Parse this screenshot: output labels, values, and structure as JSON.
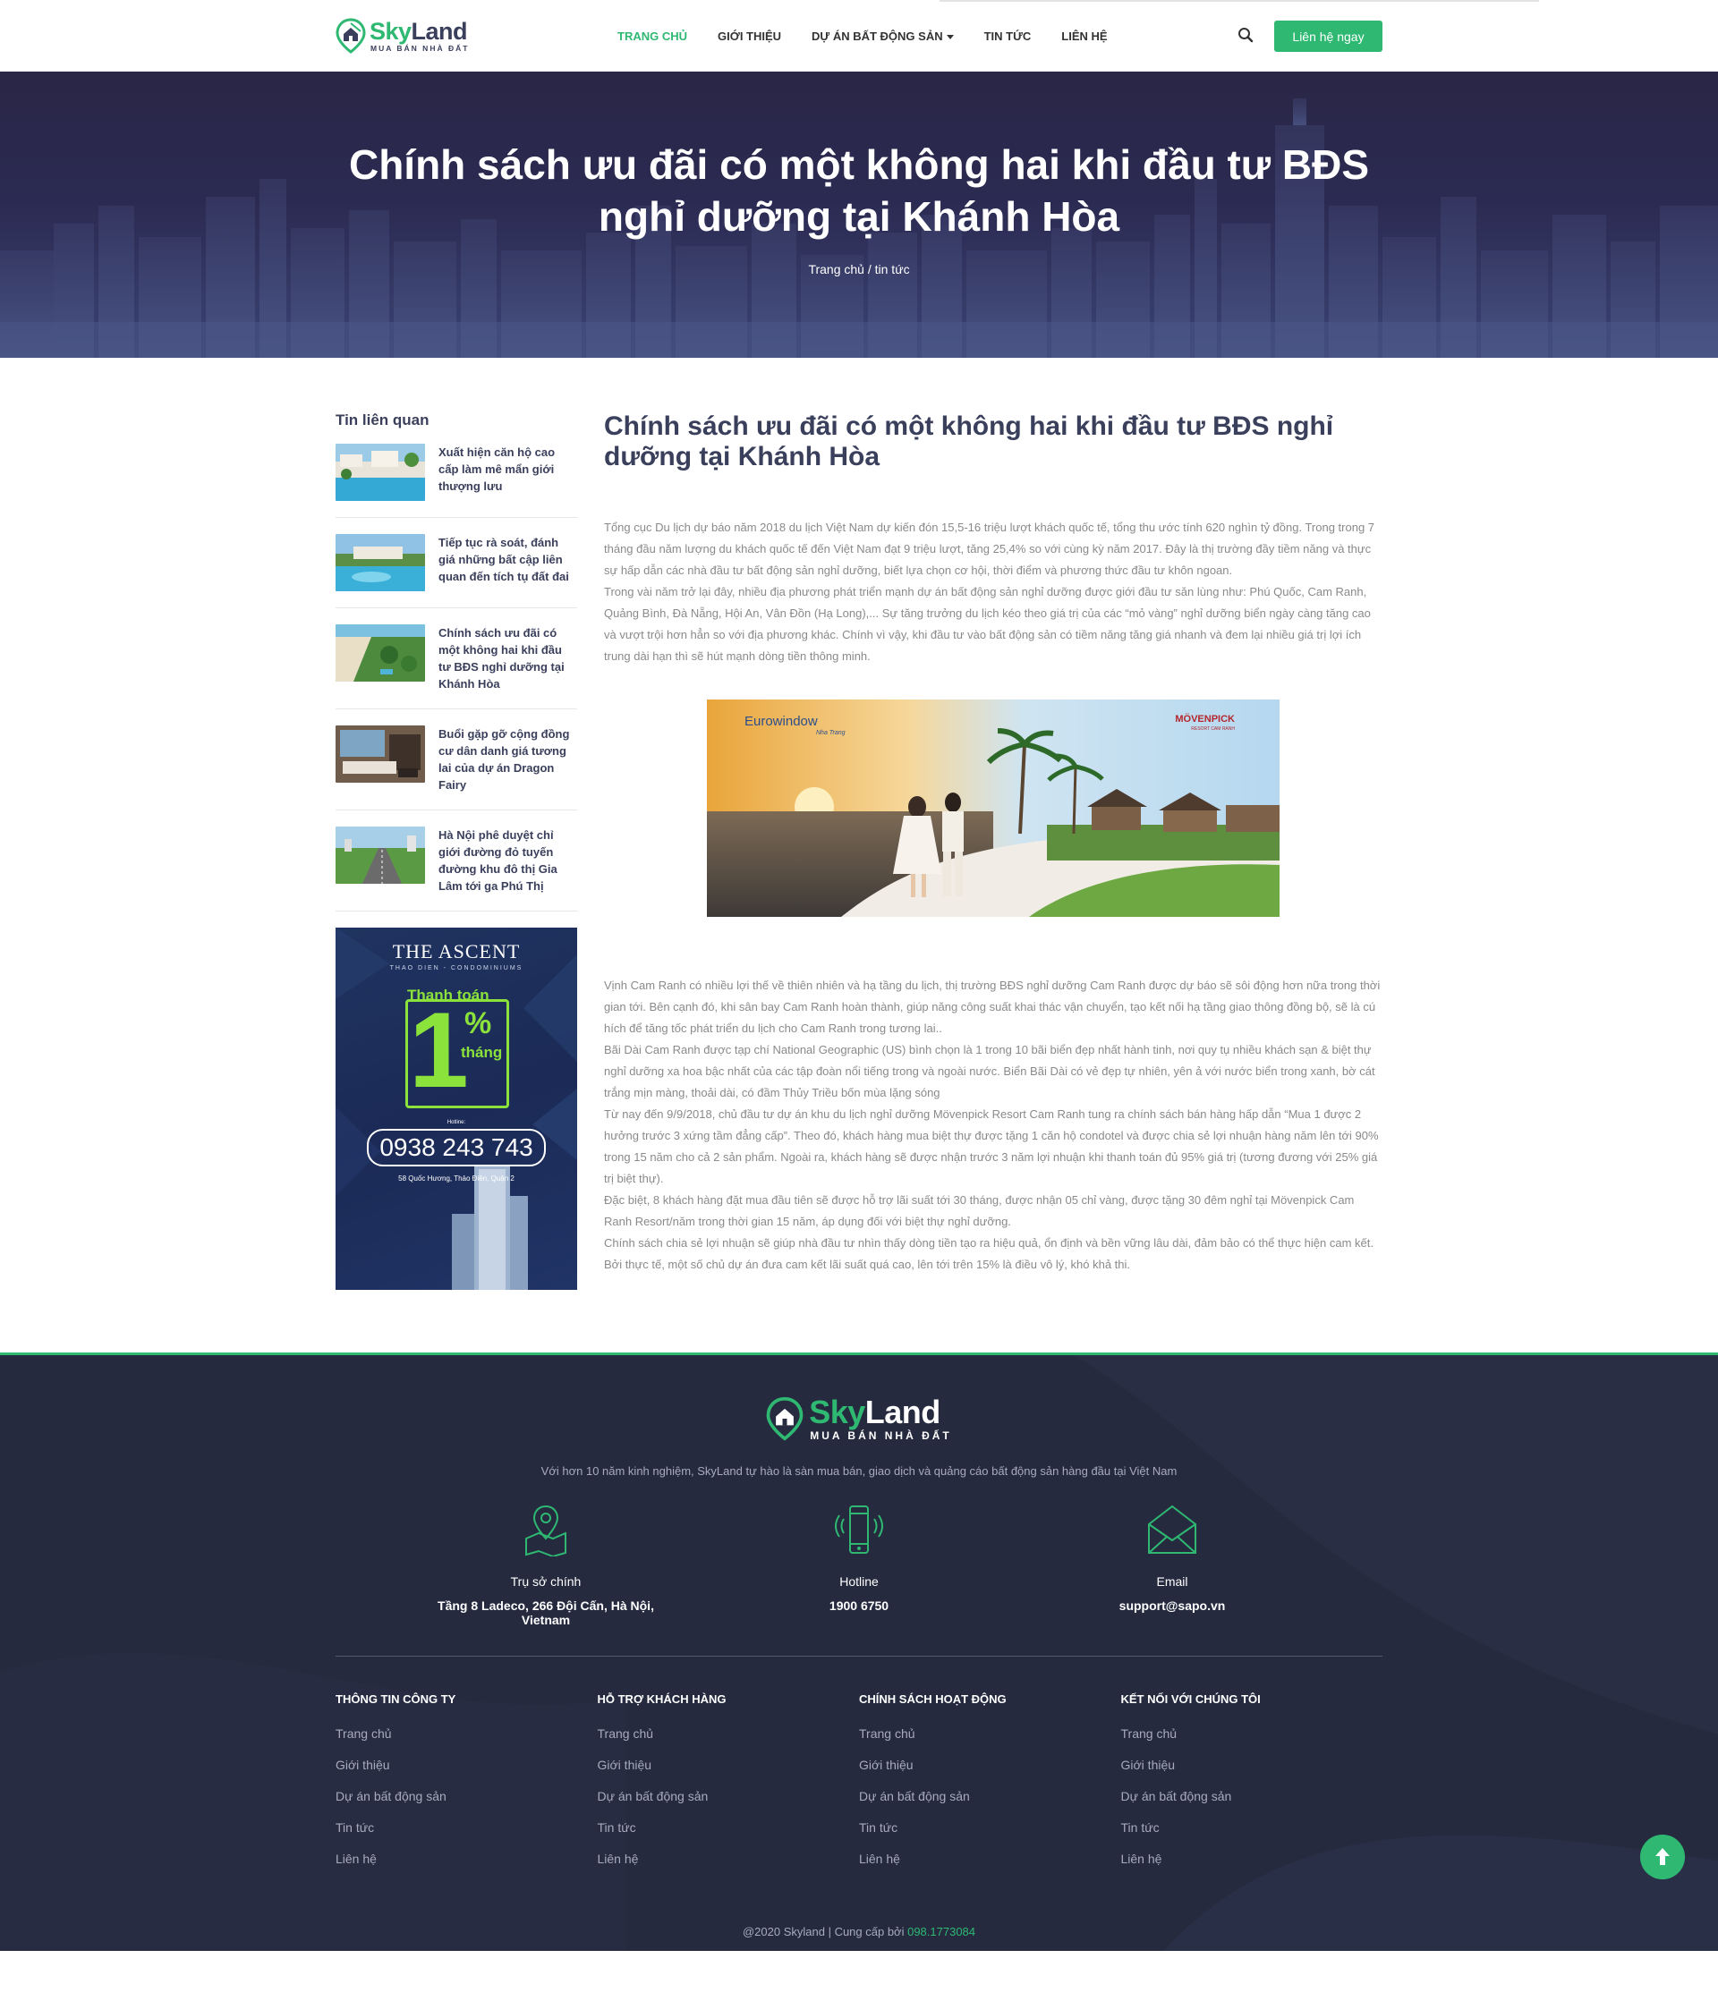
{
  "header": {
    "logo_brand_sky": "Sky",
    "logo_brand_land": "Land",
    "logo_tagline": "MUA BÁN NHÀ ĐẤT",
    "nav": [
      {
        "label": "TRANG CHỦ",
        "active": true
      },
      {
        "label": "GIỚI THIỆU"
      },
      {
        "label": "DỰ ÁN BẤT ĐỘNG SẢN",
        "dropdown": true
      },
      {
        "label": "TIN TỨC"
      },
      {
        "label": "LIÊN HỆ"
      }
    ],
    "cta_label": "Liên hệ ngay",
    "search_icon": "search-icon"
  },
  "hero": {
    "title": "Chính sách ưu đãi có một không hai khi đầu tư BĐS nghỉ dưỡng tại Khánh Hòa",
    "breadcrumb_home": "Trang chủ",
    "breadcrumb_sep": " / ",
    "breadcrumb_current": "tin tức"
  },
  "sidebar": {
    "title": "Tin liên quan",
    "items": [
      {
        "title": "Xuất hiện căn hộ cao cấp làm mê mẩn giới thượng lưu"
      },
      {
        "title": "Tiếp tục rà soát, đánh giá những bất cập liên quan đến tích tụ đất đai"
      },
      {
        "title": "Chính sách ưu đãi có một không hai khi đầu tư BĐS nghỉ dưỡng tại Khánh Hòa"
      },
      {
        "title": "Buổi gặp gỡ cộng đồng cư dân danh giá tương lai của dự án Dragon Fairy"
      },
      {
        "title": "Hà Nội phê duyệt chỉ giới đường đỏ tuyến đường khu đô thị Gia Lâm tới ga Phú Thị"
      }
    ],
    "banner": {
      "brand": "THE ASCENT",
      "brand_sub": "THAO DIEN - CONDOMINIUMS",
      "pay_label": "Thanh toán",
      "big_number": "1",
      "percent": "%",
      "per": "tháng",
      "hotline_label": "Hotline:",
      "phone": "0938 243 743",
      "address": "58 Quốc Hương, Thảo Điền, Quận 2"
    }
  },
  "article": {
    "title": "Chính sách ưu đãi có một không hai khi đầu tư BĐS nghỉ dưỡng tại Khánh Hòa",
    "intro_1": "Tổng cục Du lịch dự báo năm 2018 du lịch Việt Nam dự kiến đón 15,5-16 triệu lượt khách quốc tế, tổng thu ước tính 620 nghìn tỷ đồng. Trong trong 7 tháng đầu năm lượng du khách quốc tế đến Việt Nam đạt 9 triệu lượt, tăng 25,4% so với cùng kỳ năm 2017. Đây là thị trường đầy tiềm năng và thực sự hấp dẫn các nhà đầu tư bất động sản nghỉ dưỡng, biết lựa chọn cơ hội, thời điểm và phương thức đầu tư khôn ngoan.",
    "intro_2": "Trong vài năm trở lại đây, nhiều địa phương phát triển mạnh dự án bất động sản nghỉ dưỡng được giới đầu tư săn lùng như: Phú Quốc, Cam Ranh, Quảng Bình, Đà Nẵng, Hội An, Vân Đồn (Hạ Long),... Sự tăng trưởng du lịch kéo theo giá trị của các “mỏ vàng” nghỉ dưỡng biển ngày càng tăng cao và vượt trội hơn hẳn so với địa phương khác. Chính vì vậy, khi đầu tư vào bất động sản có tiềm năng tăng giá nhanh và đem lại nhiều giá trị lợi ích trung dài hạn thì sẽ hút mạnh dòng tiền thông minh.",
    "image_brand_left": "Eurowindow",
    "image_brand_left_sub": "Nha Trang",
    "image_brand_right": "MÖVENPICK",
    "image_brand_right_sub": "RESORT CAM RANH",
    "body": [
      "Vịnh Cam Ranh có nhiều lợi thế về thiên nhiên và hạ tầng du lịch, thị trường BĐS nghỉ dưỡng Cam Ranh được dự báo sẽ sôi động hơn nữa trong thời gian tới. Bên cạnh đó, khi sân bay Cam Ranh hoàn thành, giúp năng công suất khai thác vận chuyển, tạo kết nối hạ tầng giao thông đồng bộ, sẽ là cú hích để tăng tốc phát triển du lịch cho Cam Ranh trong tương lai..",
      "Bãi Dài Cam Ranh được tạp chí National Geographic (US) bình chọn là 1 trong 10 bãi biển đẹp nhất hành tinh, nơi quy tụ nhiều khách sạn & biệt thự nghỉ dưỡng xa hoa bậc nhất của các tập đoàn nổi tiếng trong và ngoài nước. Biển Bãi Dài có vẻ đẹp tự nhiên, yên ả với nước biển trong xanh, bờ cát trắng mịn màng, thoải dài, có đầm Thủy Triều bốn mùa lặng sóng",
      "Từ nay đến 9/9/2018, chủ đầu tư dự án khu du lịch nghỉ dưỡng Mövenpick Resort Cam Ranh tung ra chính sách bán hàng hấp dẫn “Mua 1 được 2 hưởng trước 3 xứng tầm đẳng cấp”. Theo đó, khách hàng mua biệt thự được tặng 1 căn hộ condotel và được chia sẻ lợi nhuận hàng năm lên tới 90% trong 15 năm cho cả 2 sản phẩm. Ngoài ra, khách hàng sẽ được nhận trước 3 năm lợi nhuận khi thanh toán đủ 95% giá trị (tương đương với 25% giá trị biệt thự).",
      "Đặc biệt, 8 khách hàng đặt mua đầu tiên sẽ được hỗ trợ lãi suất tới 30 tháng, được nhận 05 chỉ vàng, được tặng 30 đêm nghỉ tại Mövenpick Cam Ranh Resort/năm trong thời gian 15 năm, áp dụng đối với biệt thự nghỉ dưỡng.",
      "Chính sách chia sẻ lợi nhuận sẽ giúp nhà đầu tư nhìn thấy dòng tiền tạo ra hiệu quả, ổn định và bền vững lâu dài, đảm bảo có thể thực hiện cam kết. Bởi thực tế, một số chủ dự án đưa cam kết lãi suất quá cao, lên tới trên 15% là điều vô lý, khó khả thi."
    ]
  },
  "footer": {
    "logo_brand_sky": "Sky",
    "logo_brand_land": "Land",
    "logo_tagline": "MUA BÁN NHÀ ĐẤT",
    "description": "Với hơn 10 năm kinh nghiệm, SkyLand tự hào là sàn mua bán, giao dịch và quảng cáo bất động sản hàng đầu tại Việt Nam",
    "contacts": [
      {
        "icon": "map-pin-icon",
        "label": "Trụ sở chính",
        "value": "Tầng 8 Ladeco, 266 Đội Cấn, Hà Nội, Vietnam"
      },
      {
        "icon": "phone-icon",
        "label": "Hotline",
        "value": "1900 6750"
      },
      {
        "icon": "envelope-icon",
        "label": "Email",
        "value": "support@sapo.vn"
      }
    ],
    "columns": [
      {
        "title": "THÔNG TIN CÔNG TY",
        "links": [
          "Trang chủ",
          "Giới thiệu",
          "Dự án bất động sản",
          "Tin tức",
          "Liên hệ"
        ]
      },
      {
        "title": "HỖ TRỢ KHÁCH HÀNG",
        "links": [
          "Trang chủ",
          "Giới thiệu",
          "Dự án bất động sản",
          "Tin tức",
          "Liên hệ"
        ]
      },
      {
        "title": "CHÍNH SÁCH HOẠT ĐỘNG",
        "links": [
          "Trang chủ",
          "Giới thiệu",
          "Dự án bất động sản",
          "Tin tức",
          "Liên hệ"
        ]
      },
      {
        "title": "KẾT NỐI VỚI CHÚNG TÔI",
        "links": [
          "Trang chủ",
          "Giới thiệu",
          "Dự án bất động sản",
          "Tin tức",
          "Liên hệ"
        ]
      }
    ],
    "copyright": "@2020 Skyland | Cung cấp bởi ",
    "copyright_phone": "098.1773084"
  },
  "colors": {
    "accent": "#2eb872",
    "heading": "#3a3f5c",
    "footer_bg": "#262b40",
    "hero_bg": "#2b2a52"
  }
}
